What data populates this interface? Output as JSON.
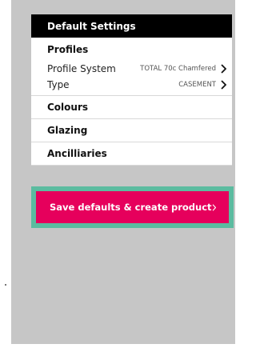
{
  "settings": {
    "title": "Default Settings",
    "sections": {
      "profiles": "Profiles",
      "colours": "Colours",
      "glazing": "Glazing",
      "ancillaries": "Ancilliaries"
    },
    "rows": [
      {
        "label": "Profile System",
        "value": "TOTAL 70c Chamfered"
      },
      {
        "label": "Type",
        "value": "CASEMENT"
      }
    ]
  },
  "cta": {
    "label": "Save defaults & create product"
  },
  "colors": {
    "accent": "#e6005c",
    "focus_outline": "#5bbca0",
    "header_bg": "#000000",
    "backdrop": "#c6c6c6"
  },
  "icons": {
    "row_chevron": "chevron-right-icon",
    "cta_chevron": "chevron-right-icon"
  }
}
